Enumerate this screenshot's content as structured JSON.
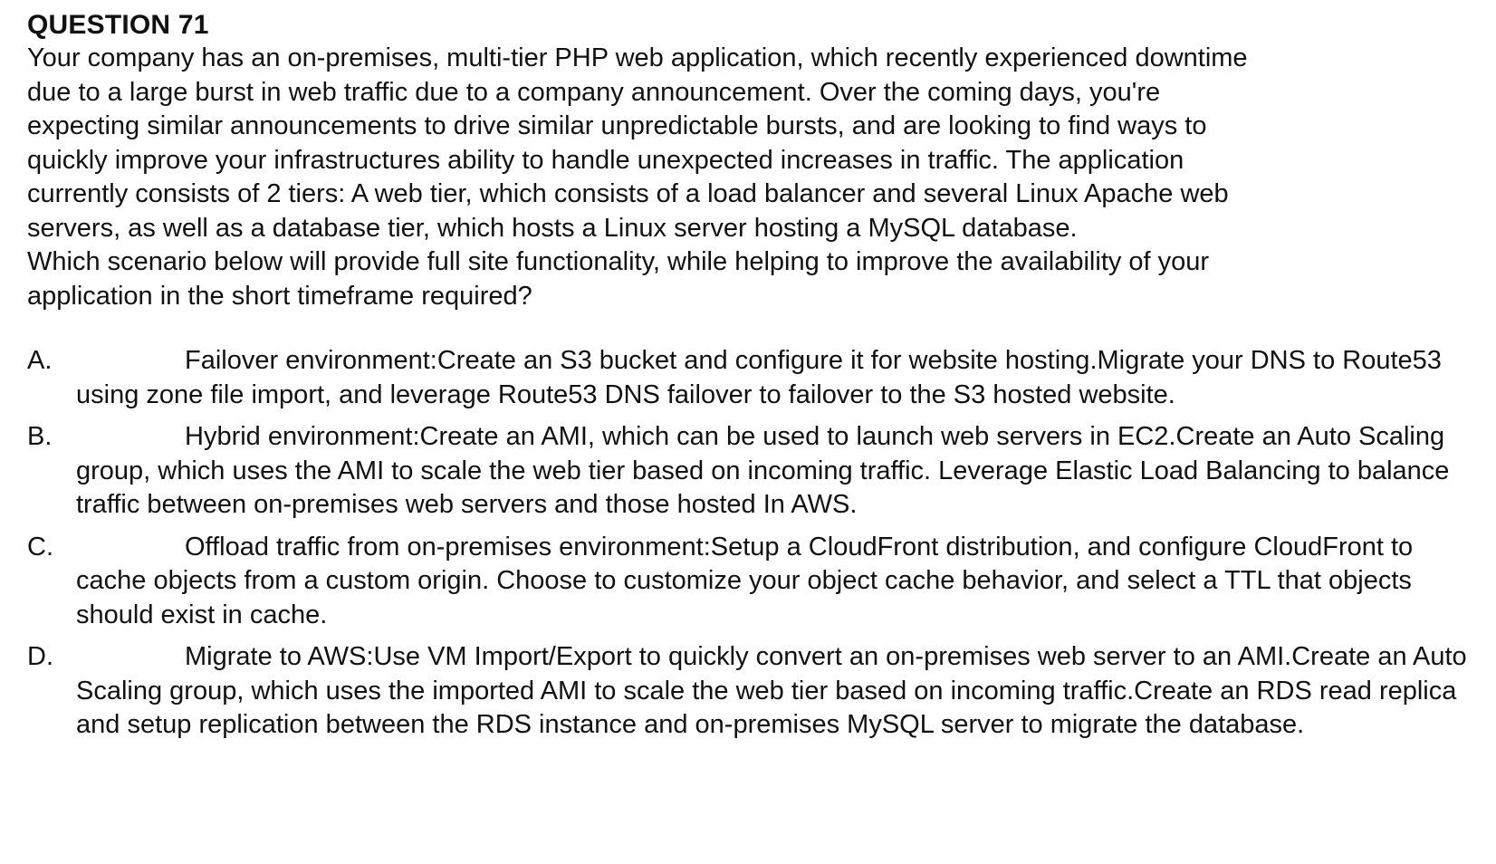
{
  "question": {
    "title": "QUESTION 71",
    "stem": "Your company has an on-premises, multi-tier PHP web application, which recently experienced downtime\ndue to a large burst in web traffic due to a company announcement. Over the coming days, you're\nexpecting similar announcements to drive similar unpredictable bursts, and are looking to find ways to\nquickly improve your infrastructures ability to handle unexpected increases in traffic. The application\ncurrently consists of 2 tiers: A web tier, which consists of a load balancer and several Linux Apache web\nservers, as well as a database tier, which hosts a Linux server hosting a MySQL database.\nWhich scenario below will provide full site functionality, while helping to improve the availability of your\napplication in the short timeframe required?"
  },
  "options": [
    {
      "letter": "A.",
      "text": "Failover environment:Create an S3 bucket and configure it for website hosting.Migrate your DNS to Route53 using zone file import, and leverage Route53 DNS failover to failover to the S3 hosted website."
    },
    {
      "letter": "B.",
      "text": "Hybrid environment:Create an AMI, which can be used to launch web servers in EC2.Create an Auto Scaling group, which uses the AMI to scale the web tier based on incoming traffic. Leverage Elastic Load Balancing to balance traffic between on-premises web servers and those hosted In AWS."
    },
    {
      "letter": "C.",
      "text": "Offload traffic from on-premises environment:Setup a CloudFront distribution, and configure CloudFront to cache objects from a custom origin. Choose to customize your object cache behavior, and select a TTL that objects should exist in cache."
    },
    {
      "letter": "D.",
      "text": "Migrate to AWS:Use VM Import/Export to quickly convert an on-premises web server to an AMI.Create an Auto Scaling group, which uses the imported AMI to scale the web tier based on incoming traffic.Create an RDS read replica and setup replication between the RDS instance and on-premises MySQL server to migrate the database."
    }
  ]
}
